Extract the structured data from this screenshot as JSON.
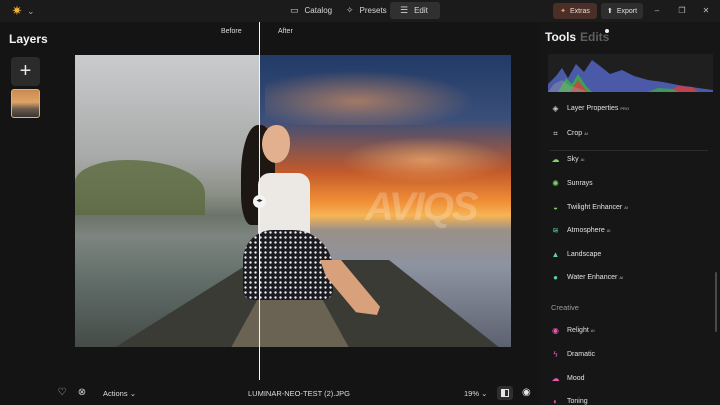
{
  "topbar": {
    "app_icon": "sun-logo-icon",
    "tabs": [
      {
        "label": "Catalog",
        "icon": "folder-icon"
      },
      {
        "label": "Presets",
        "icon": "sparkle-icon"
      },
      {
        "label": "Edit",
        "icon": "sliders-icon",
        "active": true
      }
    ],
    "extras_label": "Extras",
    "export_label": "Export",
    "extras_color": "#4a2e28"
  },
  "layers": {
    "title": "Layers",
    "add_label": "+"
  },
  "canvas": {
    "before_label": "Before",
    "after_label": "After",
    "watermark_text": "AVIQS"
  },
  "bottom_bar": {
    "actions_label": "Actions",
    "filename": "LUMINAR-NEO-TEST (2).JPG",
    "zoom": "19%"
  },
  "tools_panel": {
    "tools_title": "Tools",
    "edits_title": "Edits",
    "items_top": [
      {
        "label": "Layer Properties",
        "badge": "PRO",
        "icon": "layers-icon",
        "color": "#cfcfcf"
      },
      {
        "label": "Crop",
        "badge": "AI",
        "icon": "crop-icon",
        "color": "#cfcfcf"
      }
    ],
    "items_ai": [
      {
        "label": "Sky",
        "badge": "AI",
        "icon": "cloud-icon",
        "color": "#7fd46a"
      },
      {
        "label": "Sunrays",
        "badge": "",
        "icon": "sun-icon",
        "color": "#7fd46a"
      },
      {
        "label": "Twilight Enhancer",
        "badge": "AI",
        "icon": "twilight-icon",
        "color": "#7fd46a"
      },
      {
        "label": "Atmosphere",
        "badge": "AI",
        "icon": "atmosphere-icon",
        "color": "#5ad0b0"
      },
      {
        "label": "Landscape",
        "badge": "",
        "icon": "landscape-icon",
        "color": "#5ad0b0"
      },
      {
        "label": "Water Enhancer",
        "badge": "AI",
        "icon": "water-drop-icon",
        "color": "#5ad0b0"
      }
    ],
    "creative_label": "Creative",
    "items_creative": [
      {
        "label": "Relight",
        "badge": "AI",
        "icon": "relight-icon",
        "color": "#e85ab0"
      },
      {
        "label": "Dramatic",
        "badge": "",
        "icon": "lightning-icon",
        "color": "#e85ab0"
      },
      {
        "label": "Mood",
        "badge": "",
        "icon": "mood-icon",
        "color": "#e85ab0"
      },
      {
        "label": "Toning",
        "badge": "",
        "icon": "toning-icon",
        "color": "#e85ab0"
      }
    ]
  }
}
